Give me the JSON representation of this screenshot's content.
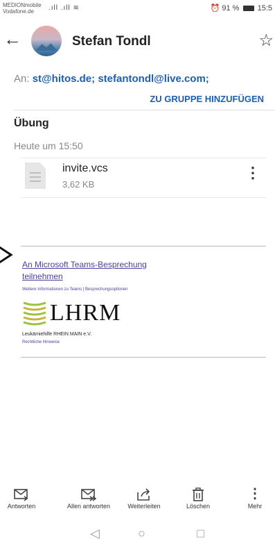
{
  "status_bar": {
    "carrier_line1": "MEDIONmobile",
    "carrier_line2": "Vodafone.de",
    "signals": ".ıll .ıll ≋",
    "alarm_icon": "alarm-icon",
    "battery_text": "91 %",
    "time": "15:5"
  },
  "app_bar": {
    "back_icon": "←",
    "sender_name": "Stefan Tondl",
    "star_icon": "☆"
  },
  "recipients": {
    "prefix": "An:",
    "addresses": "st@hitos.de; stefantondl@live.com;",
    "add_group_label": "ZU GRUPPE HINZUFÜGEN"
  },
  "message": {
    "subject": "Übung",
    "timestamp": "Heute um 15:50"
  },
  "attachment": {
    "file_name": "invite.vcs",
    "file_size": "3,62 KB",
    "more_icon": "⋮"
  },
  "body": {
    "teams_link_line1": "An Microsoft Teams-Besprechung",
    "teams_link_line2": "teilnehmen",
    "teams_subline": "Weitere Informationen zu Teams | Besprechungsoptionen",
    "logo_text": "LHRM",
    "org_name": "Leukämiehilfe RHEIN MAIN e.V.",
    "legal_link": "Rechtliche Hinweise"
  },
  "actions": [
    {
      "label": "Antworten",
      "icon": "reply-icon"
    },
    {
      "label": "Allen antworten",
      "icon": "reply-all-icon"
    },
    {
      "label": "Weiterleiten",
      "icon": "forward-icon"
    },
    {
      "label": "Löschen",
      "icon": "trash-icon"
    },
    {
      "label": "Mehr",
      "icon": "more-icon"
    }
  ],
  "colors": {
    "accent": "#1b5fb4",
    "link": "#4a3f9c"
  }
}
